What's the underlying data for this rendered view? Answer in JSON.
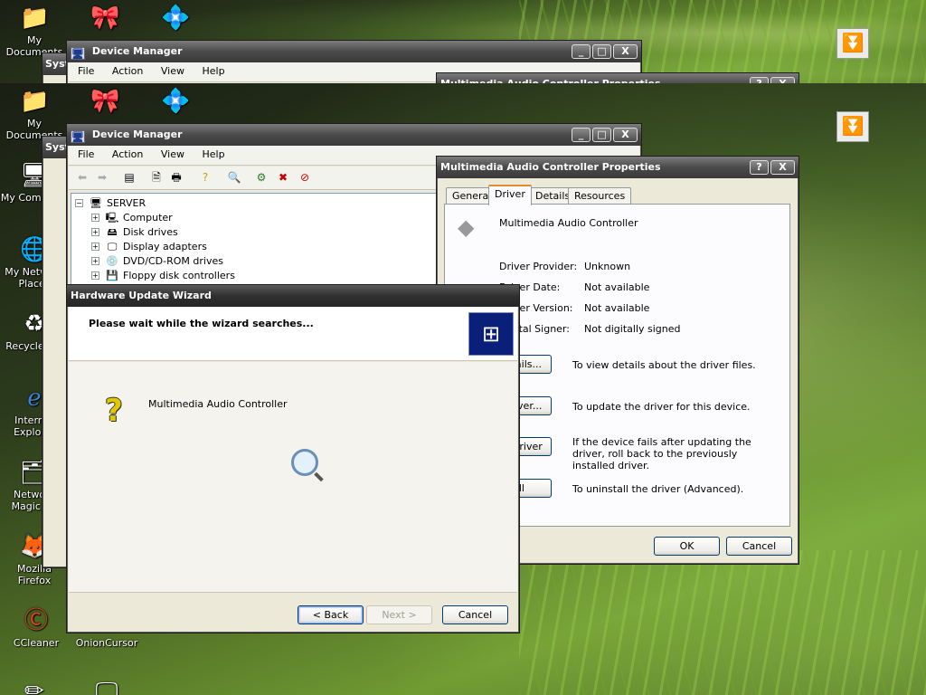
{
  "desktop_icons": {
    "my_documents": "My Documents",
    "my_computer": "My Computer",
    "my_network": "My Network Places",
    "recycle": "Recycle Bin",
    "ie": "Internet Explorer",
    "network_magic": "Network Magic F...",
    "firefox": "Mozilla Firefox",
    "ccleaner": "CCleaner",
    "onioncursor": "OnionCursor"
  },
  "behind_window_title": "Syst",
  "device_manager": {
    "title": "Device Manager",
    "menu": [
      "File",
      "Action",
      "View",
      "Help"
    ],
    "tree": {
      "root": "SERVER",
      "items": [
        "Computer",
        "Disk drives",
        "Display adapters",
        "DVD/CD-ROM drives",
        "Floppy disk controllers"
      ]
    }
  },
  "properties": {
    "title": "Multimedia Audio Controller Properties",
    "tabs": [
      "General",
      "Driver",
      "Details",
      "Resources"
    ],
    "device_name": "Multimedia Audio Controller",
    "fields": {
      "provider_label": "Driver Provider:",
      "provider_value": "Unknown",
      "date_label": "Driver Date:",
      "date_value": "Not available",
      "version_label": "Driver Version:",
      "version_value": "Not available",
      "signer_label": "Digital Signer:",
      "signer_value": "Not digitally signed"
    },
    "buttons": {
      "details": "Driver Details...",
      "update": "Update Driver...",
      "rollback": "Roll Back Driver",
      "uninstall": "Uninstall"
    },
    "descriptions": {
      "details": "To view details about the driver files.",
      "update": "To update the driver for this device.",
      "rollback": "If the device fails after updating the driver, roll back to the previously installed driver.",
      "uninstall": "To uninstall the driver (Advanced)."
    },
    "ok": "OK",
    "cancel": "Cancel"
  },
  "wizard": {
    "title": "Hardware Update Wizard",
    "heading": "Please wait while the wizard searches...",
    "device": "Multimedia Audio Controller",
    "back": "< Back",
    "next": "Next >",
    "cancel": "Cancel"
  },
  "window_buttons": {
    "help": "?",
    "close": "X",
    "min": "_",
    "max": "□"
  },
  "tray_symbol": "⏬",
  "colors": {
    "accent_tab": "#e68b2c",
    "titlebar": "#3a3a3a",
    "wizard_logo": "#0a1f7a"
  }
}
